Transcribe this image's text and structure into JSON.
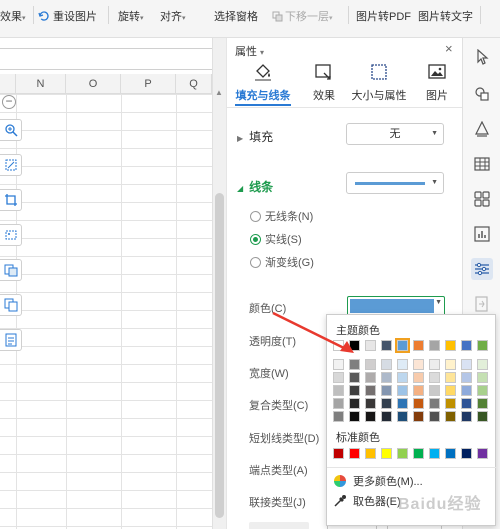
{
  "toolbar": {
    "items": [
      {
        "label": "效果",
        "caret": "▾",
        "disabled": false
      },
      {
        "label": "重设图片",
        "disabled": false
      },
      {
        "label": "旋转",
        "caret": "▾",
        "disabled": false
      },
      {
        "label": "对齐",
        "caret": "▾",
        "disabled": false
      },
      {
        "label": "选择窗格",
        "disabled": false
      },
      {
        "label": "下移一层",
        "caret": "▾",
        "disabled": true
      },
      {
        "label": "图片转PDF",
        "disabled": false
      },
      {
        "label": "图片转文字",
        "disabled": false
      }
    ]
  },
  "sheet": {
    "columns": [
      "N",
      "O",
      "P",
      "Q"
    ],
    "minus_glyph": "−"
  },
  "panel": {
    "title": "属性",
    "title_caret": "▾",
    "close": "×",
    "tabs": [
      {
        "label": "填充与线条",
        "icon": "fill-bucket-icon",
        "active": true
      },
      {
        "label": "效果",
        "icon": "effects-icon",
        "active": false
      },
      {
        "label": "大小与属性",
        "icon": "size-icon",
        "active": false
      },
      {
        "label": "图片",
        "icon": "picture-icon",
        "active": false
      }
    ],
    "fill": {
      "label": "填充",
      "value": "无",
      "collapsed_glyph": "▶"
    },
    "line": {
      "label": "线条",
      "expanded_glyph": "◢",
      "options": [
        {
          "label": "无线条(N)",
          "checked": false
        },
        {
          "label": "实线(S)",
          "checked": true
        },
        {
          "label": "渐变线(G)",
          "checked": false
        }
      ],
      "line_color": "#5b9bd5"
    },
    "props": [
      "颜色(C)",
      "透明度(T)",
      "宽度(W)",
      "复合类型(C)",
      "短划线类型(D)",
      "端点类型(A)",
      "联接类型(J)"
    ]
  },
  "color_popup": {
    "theme_title": "主题颜色",
    "standard_title": "标准颜色",
    "theme_top": [
      "#ffffff",
      "#000000",
      "#e7e6e6",
      "#44546a",
      "#5b9bd5",
      "#ed7d31",
      "#a5a5a5",
      "#ffc000",
      "#4472c4",
      "#70ad47"
    ],
    "theme_shades": [
      [
        "#f2f2f2",
        "#7f7f7f",
        "#d0cece",
        "#d6dce4",
        "#deebf6",
        "#fbe5d5",
        "#ededed",
        "#fff2cc",
        "#d9e2f3",
        "#e2efd9"
      ],
      [
        "#d8d8d8",
        "#595959",
        "#aeabab",
        "#adb9ca",
        "#bdd7ee",
        "#f7cbac",
        "#dbdbdb",
        "#fee599",
        "#b4c6e7",
        "#c5e0b3"
      ],
      [
        "#bfbfbf",
        "#3f3f3f",
        "#757070",
        "#8496b0",
        "#9dc3e6",
        "#f4b183",
        "#c9c9c9",
        "#ffd965",
        "#8eaadb",
        "#a8d08d"
      ],
      [
        "#a5a5a5",
        "#262626",
        "#3a3838",
        "#323f4f",
        "#2e75b5",
        "#c55a11",
        "#7b7b7b",
        "#bf9000",
        "#2f5496",
        "#538135"
      ],
      [
        "#7f7f7f",
        "#0c0c0c",
        "#171616",
        "#222a35",
        "#1e4e79",
        "#833c0b",
        "#525252",
        "#7f6000",
        "#1f3864",
        "#375623"
      ]
    ],
    "standard": [
      "#c00000",
      "#ff0000",
      "#ffc000",
      "#ffff00",
      "#92d050",
      "#00b050",
      "#00b0f0",
      "#0070c0",
      "#002060",
      "#7030a0"
    ],
    "more_colors": "更多颜色(M)...",
    "eyedropper": "取色器(E)"
  },
  "watermark": "Baidu经验",
  "colors": {
    "accent_blue": "#2a7ad4",
    "accent_green": "#1e9b4e",
    "arrow_red": "#e8392e"
  }
}
